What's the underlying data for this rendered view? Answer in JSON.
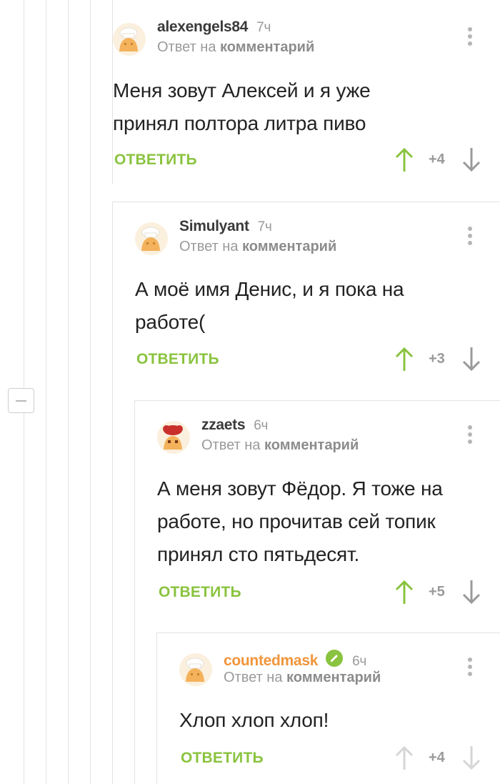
{
  "comments": [
    {
      "author": "alexengels84",
      "time": "7ч",
      "reply_prefix": "Ответ на",
      "reply_target": "комментарий",
      "lines": [
        "Меня зовут Алексей и я уже",
        "принял полтора литра пиво"
      ],
      "reply_label": "ОТВЕТИТЬ",
      "score": "+4",
      "avatar_icon": "chef-hat-avatar-icon"
    },
    {
      "author": "Simulyant",
      "time": "7ч",
      "reply_prefix": "Ответ на",
      "reply_target": "комментарий",
      "lines": [
        "А моё имя Денис, и я пока на",
        "работе("
      ],
      "reply_label": "ОТВЕТИТЬ",
      "score": "+3",
      "avatar_icon": "chef-hat-avatar-icon"
    },
    {
      "author": "zzaets",
      "time": "6ч",
      "reply_prefix": "Ответ на",
      "reply_target": "комментарий",
      "lines": [
        "А меня зовут Фёдор. Я тоже на",
        "работе, но прочитав сей топик",
        "принял сто пятьдесят."
      ],
      "reply_label": "ОТВЕТИТЬ",
      "score": "+5",
      "avatar_icon": "red-hat-avatar-icon"
    },
    {
      "author": "countedmask",
      "time": "6ч",
      "reply_prefix": "Ответ на",
      "reply_target": "комментарий",
      "lines": [
        "Хлоп хлоп хлоп!"
      ],
      "reply_label": "ОТВЕТИТЬ",
      "score": "+4",
      "avatar_icon": "chef-hat-avatar-icon",
      "verified": true
    }
  ],
  "colors": {
    "accent_green": "#8ac33f",
    "author_orange": "#f0953a",
    "muted": "#9a9a9a"
  }
}
